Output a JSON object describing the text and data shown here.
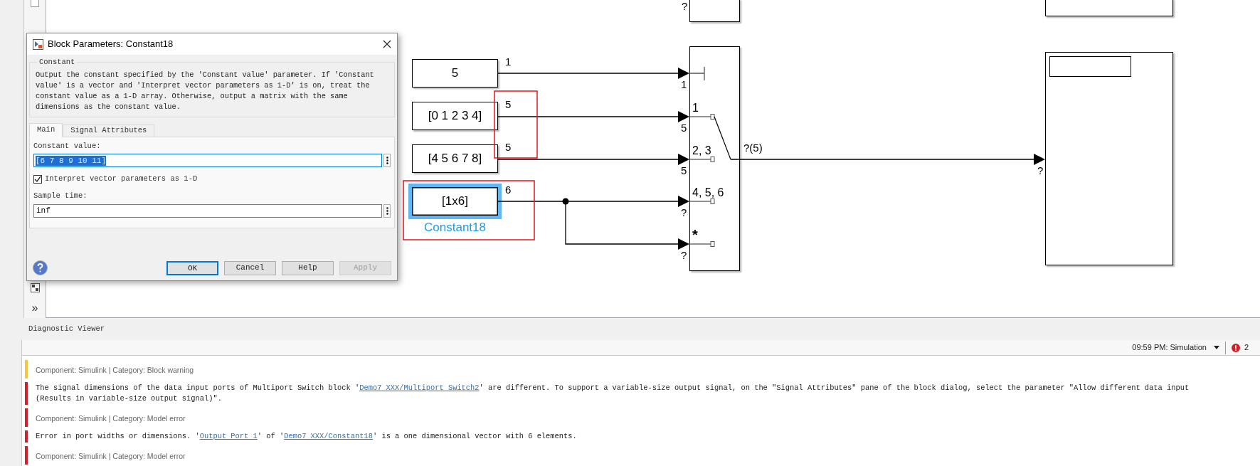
{
  "toolbar": {
    "more_glyph": "»"
  },
  "diagram": {
    "constants": [
      {
        "value": "5",
        "signal": "1",
        "selected": false
      },
      {
        "value": "[0 1 2 3 4]",
        "signal": "5",
        "selected": false
      },
      {
        "value": "[4 5 6 7 8]",
        "signal": "5",
        "selected": false
      },
      {
        "value": "[1x6]",
        "signal": "6",
        "selected": true,
        "name": "Constant18"
      }
    ],
    "switch_ports": [
      {
        "kind": "control",
        "dimension": "1"
      },
      {
        "kind": "data",
        "label": "1",
        "dimension": "5"
      },
      {
        "kind": "data",
        "label": "2, 3",
        "dimension": "5"
      },
      {
        "kind": "data",
        "label": "4, 5, 6",
        "dimension": "?"
      },
      {
        "kind": "data",
        "label": "*",
        "dimension": "?"
      }
    ],
    "switch_output": "?(5)",
    "top_block_input": "?",
    "display_input": "?"
  },
  "dialog": {
    "title": "Block Parameters: Constant18",
    "group_title": "Constant",
    "description": "Output the constant specified by the 'Constant value' parameter. If 'Constant value' is a vector and 'Interpret vector parameters as 1-D' is on, treat the constant value as a 1-D array. Otherwise, output a matrix with the same dimensions as the constant value.",
    "tabs": [
      {
        "label": "Main",
        "selected": true
      },
      {
        "label": "Signal Attributes",
        "selected": false
      }
    ],
    "constant_value": {
      "label": "Constant value:",
      "value": "[6 7 8 9 10 11]",
      "text_selected": true
    },
    "interpret_vector": {
      "label": "Interpret vector parameters as 1-D",
      "checked": true
    },
    "sample_time": {
      "label": "Sample time:",
      "value": "inf"
    },
    "buttons": [
      {
        "label": "OK",
        "default": true,
        "disabled": false
      },
      {
        "label": "Cancel",
        "default": false,
        "disabled": false
      },
      {
        "label": "Help",
        "default": false,
        "disabled": false
      },
      {
        "label": "Apply",
        "default": false,
        "disabled": true
      }
    ]
  },
  "diagnostic_viewer": {
    "title": "Diagnostic Viewer",
    "run": "09:59 PM: Simulation",
    "error_count": "2",
    "entries": [
      {
        "kind": "header",
        "color": "#f5c542",
        "text": "Component: Simulink | Category: Block warning"
      },
      {
        "kind": "message",
        "color": "#d0212a",
        "lines": [
          [
            {
              "text": "The signal dimensions of the data input ports of Multiport Switch block '",
              "link": false
            },
            {
              "text": "Demo7 XXX/Multiport Switch2",
              "link": true
            },
            {
              "text": "' are different. To support a variable-size output signal, on the \"Signal Attributes\" pane of the block dialog, select the parameter \"Allow different data input",
              "link": false
            }
          ],
          [
            {
              "text": "(Results in variable-size output signal)\".",
              "link": false
            }
          ]
        ]
      },
      {
        "kind": "header",
        "color": "#d0212a",
        "text": "Component: Simulink | Category: Model error"
      },
      {
        "kind": "message",
        "color": "#d0212a",
        "lines": [
          [
            {
              "text": "Error in port widths or dimensions. '",
              "link": false
            },
            {
              "text": "Output Port 1",
              "link": true
            },
            {
              "text": "' of '",
              "link": false
            },
            {
              "text": "Demo7 XXX/Constant18",
              "link": true
            },
            {
              "text": "' is a one dimensional vector with 6 elements.",
              "link": false
            }
          ]
        ]
      },
      {
        "kind": "header",
        "color": "#d0212a",
        "text": "Component: Simulink | Category: Model error"
      }
    ]
  }
}
